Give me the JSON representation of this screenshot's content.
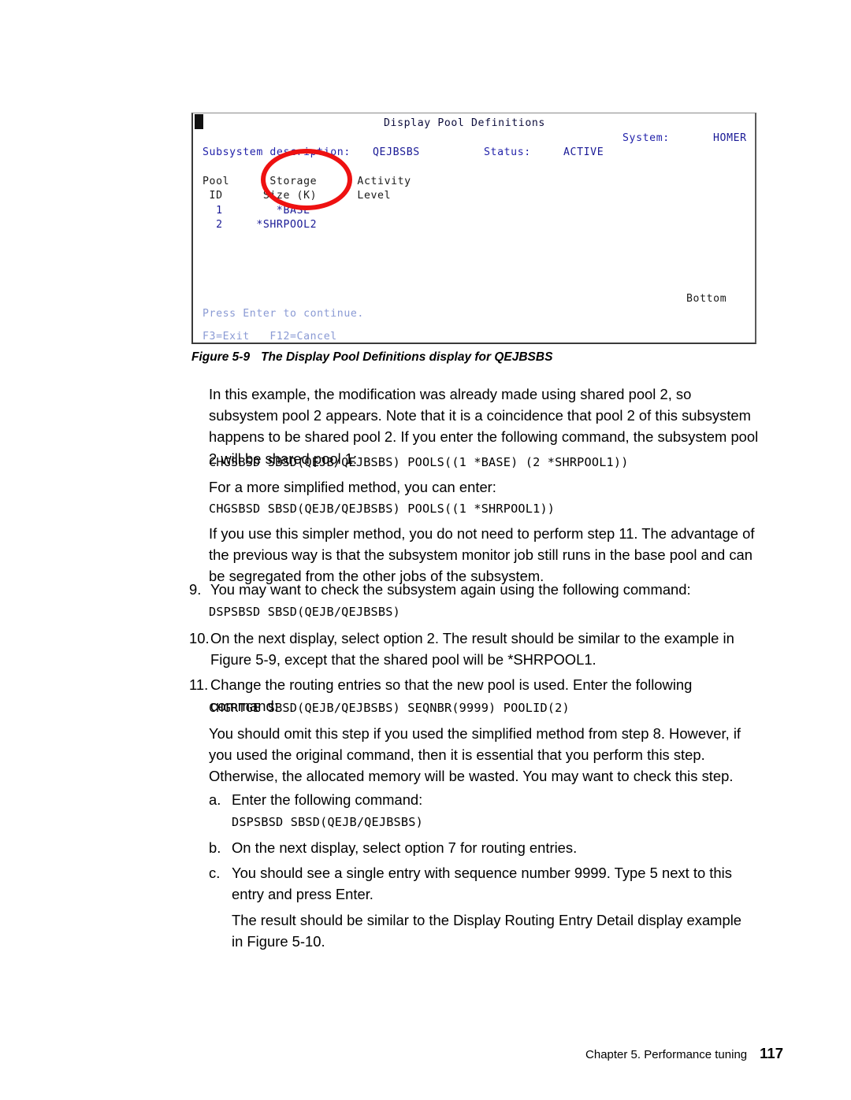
{
  "figure": {
    "terminal": {
      "title": "Display Pool Definitions",
      "system_label": "System:",
      "system_value": "HOMER",
      "subsystem_label": "Subsystem description:",
      "subsystem_value": "QEJBSBS",
      "status_label": "Status:",
      "status_value": "ACTIVE",
      "header_line1": "Pool      Storage      Activity",
      "header_line2": " ID      Size (K)      Level",
      "row1": "  1        *BASE",
      "row2": "  2     *SHRPOOL2",
      "bottom": "Bottom",
      "press_enter": "Press Enter to continue.",
      "function_keys": "F3=Exit   F12=Cancel"
    },
    "caption_number": "Figure 5-9",
    "caption_text": "The Display Pool Definitions display for QEJBSBS"
  },
  "content": {
    "para1": "In this example, the modification was already made using shared pool 2, so subsystem pool 2 appears. Note that it is a coincidence that pool 2 of this subsystem happens to be shared pool 2. If you enter the following command, the subsystem pool 2 will be shared pool 1:",
    "code1": "CHGSBSD SBSD(QEJB/QEJBSBS) POOLS((1 *BASE) (2 *SHRPOOL1))",
    "para2": "For a more simplified method, you can enter:",
    "code2": "CHGSBSD SBSD(QEJB/QEJBSBS) POOLS((1 *SHRPOOL1))",
    "para3": "If you use this simpler method, you do not need to perform step 11. The advantage of the previous way is that the subsystem monitor job still runs in the base pool and can be segregated from the other jobs of the subsystem.",
    "step9_marker": "9.",
    "step9_text": "You may want to check the subsystem again using the following command:",
    "code3": "DSPSBSD SBSD(QEJB/QEJBSBS)",
    "step10_marker": "10.",
    "step10_text": "On the next display, select option 2. The result should be similar to the example in Figure 5-9, except that the shared pool will be *SHRPOOL1.",
    "step11_marker": "11.",
    "step11_text": "Change the routing entries so that the new pool is used. Enter the following command:",
    "code4": "CHGRTGE SBSD(QEJB/QEJBSBS) SEQNBR(9999) POOLID(2)",
    "para4": "You should omit this step if you used the simplified method from step 8. However, if you used the original command, then it is essential that you perform this step. Otherwise, the allocated memory will be wasted. You may want to check this step.",
    "stepa_marker": "a.",
    "stepa_text": "Enter the following command:",
    "code5": "DSPSBSD SBSD(QEJB/QEJBSBS)",
    "stepb_marker": "b.",
    "stepb_text": "On the next display, select option 7 for routing entries.",
    "stepc_marker": "c.",
    "stepc_text": "You should see a single entry with sequence number 9999. Type 5 next to this entry and press Enter.",
    "para5": "The result should be similar to the Display Routing Entry Detail display example in Figure 5-10."
  },
  "footer": {
    "chapter": "Chapter 5. Performance tuning",
    "page_number": "117"
  },
  "colors": {
    "annotation_red": "#ee1111",
    "terminal_blue": "#2222aa",
    "terminal_faded_blue": "#8a9ad4"
  }
}
